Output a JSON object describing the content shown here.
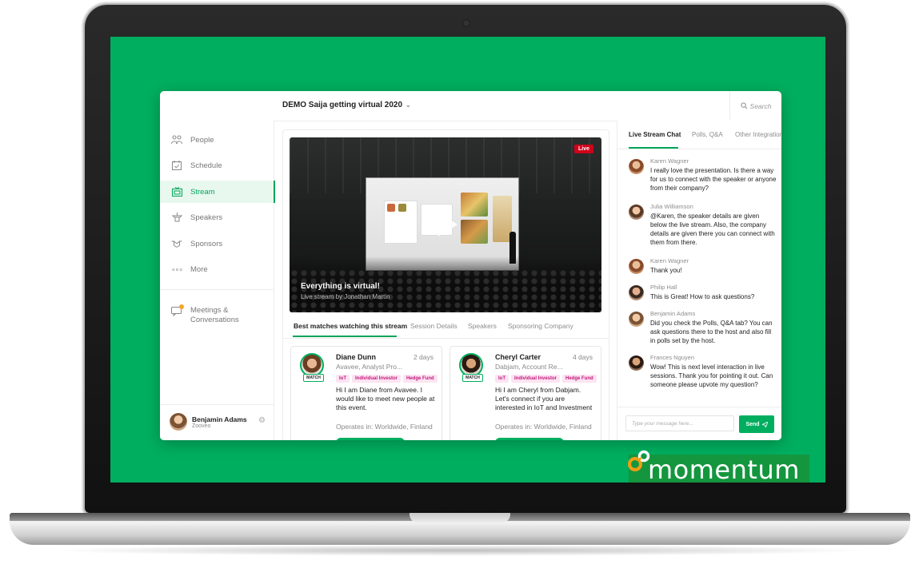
{
  "app": {
    "event_title": "DEMO Saija getting virtual 2020",
    "search_placeholder": "Search"
  },
  "sidebar": {
    "items": [
      {
        "label": "People",
        "icon": "people-icon"
      },
      {
        "label": "Schedule",
        "icon": "calendar-icon"
      },
      {
        "label": "Stream",
        "icon": "tv-icon",
        "active": true
      },
      {
        "label": "Speakers",
        "icon": "podium-icon"
      },
      {
        "label": "Sponsors",
        "icon": "handshake-icon"
      },
      {
        "label": "More",
        "icon": "more-dots-icon"
      }
    ],
    "meetings": {
      "line1": "Meetings &",
      "line2": "Conversations"
    },
    "user": {
      "name": "Benjamin Adams",
      "org": "Zooveo"
    }
  },
  "video": {
    "live_badge": "Live",
    "title": "Everything is virtual!",
    "subtitle": "Live stream by Jonathan Martin"
  },
  "main_tabs": [
    "Best matches watching this stream",
    "Session Details",
    "Speakers",
    "Sponsoring Company"
  ],
  "matches": [
    {
      "name": "Diane Dunn",
      "time": "2 days",
      "role": "Avavee, Analyst Pro...",
      "badge": "MATCH",
      "tags": [
        "IoT",
        "Individual Investor",
        "Hedge Fund"
      ],
      "message": "Hi I am Diane from Avavee. I would like to meet new people at this event.",
      "operates": "Operates in: Worldwide, Finland"
    },
    {
      "name": "Cheryl Carter",
      "time": "4 days",
      "role": "Dabjam, Account Re...",
      "badge": "MATCH",
      "tags": [
        "IoT",
        "Individual Investor",
        "Hedge Fund"
      ],
      "message": "Hi I am Cheryl from Dabjam. Let's connect if you are interested in IoT and Investment",
      "operates": "Operates in: Worldwide, Finland"
    }
  ],
  "chat": {
    "tabs": [
      "Live Stream Chat",
      "Polls, Q&A",
      "Other Integrations"
    ],
    "messages": [
      {
        "author": "Karen Wagner",
        "text": "I really love the presentation. Is there a way for us to connect with the speaker or anyone from their company?"
      },
      {
        "author": "Julia Williamson",
        "text": "@Karen, the speaker details are given below the live stream. Also, the company details are given there you can connect with them from there."
      },
      {
        "author": "Karen Wagner",
        "text": "Thank you!"
      },
      {
        "author": "Philip Hall",
        "text": "This is Great! How to ask questions?"
      },
      {
        "author": "Benjamin Adams",
        "text": "Did you check the Polls, Q&A tab? You can ask questions there to the host and also fill in polls set by the host."
      },
      {
        "author": "Frances Nguyen",
        "text": "Wow! This is next level interaction in live sessions. Thank you for pointing it out. Can someone please upvote my question?"
      }
    ],
    "input_placeholder": "Type your message here...",
    "send_label": "Send"
  },
  "brand": {
    "name": "momentum"
  },
  "colors": {
    "screen_bg": "#00ae5f",
    "accent": "#00a55a",
    "live": "#d0021b",
    "tag_bg": "#fde4f3",
    "tag_text": "#c2187a"
  }
}
